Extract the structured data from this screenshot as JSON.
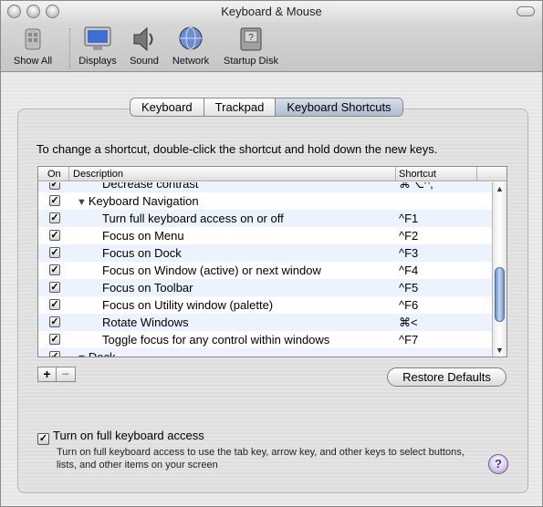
{
  "window": {
    "title": "Keyboard & Mouse"
  },
  "toolbar": {
    "show_all": "Show All",
    "items": [
      {
        "label": "Displays",
        "icon": "displays-icon"
      },
      {
        "label": "Sound",
        "icon": "speaker-icon"
      },
      {
        "label": "Network",
        "icon": "globe-icon"
      },
      {
        "label": "Startup Disk",
        "icon": "disk-icon"
      }
    ]
  },
  "tabs": [
    {
      "label": "Keyboard",
      "active": false
    },
    {
      "label": "Trackpad",
      "active": false
    },
    {
      "label": "Keyboard Shortcuts",
      "active": true
    }
  ],
  "instruction": "To change a shortcut, double-click the shortcut and hold down the new keys.",
  "table": {
    "columns": {
      "on": "On",
      "description": "Description",
      "shortcut": "Shortcut"
    },
    "rows": [
      {
        "on": true,
        "indent": 2,
        "description": "Decrease contrast",
        "shortcut": "⌘⌥^,"
      },
      {
        "on": true,
        "indent": 1,
        "group": true,
        "description": "Keyboard Navigation",
        "shortcut": ""
      },
      {
        "on": true,
        "indent": 2,
        "description": "Turn full keyboard access on or off",
        "shortcut": "^F1"
      },
      {
        "on": true,
        "indent": 2,
        "description": "Focus on Menu",
        "shortcut": "^F2"
      },
      {
        "on": true,
        "indent": 2,
        "description": "Focus on Dock",
        "shortcut": "^F3"
      },
      {
        "on": true,
        "indent": 2,
        "description": "Focus on Window (active) or next window",
        "shortcut": "^F4"
      },
      {
        "on": true,
        "indent": 2,
        "description": "Focus on Toolbar",
        "shortcut": "^F5"
      },
      {
        "on": true,
        "indent": 2,
        "description": "Focus on Utility window (palette)",
        "shortcut": "^F6"
      },
      {
        "on": true,
        "indent": 2,
        "description": "Rotate Windows",
        "shortcut": "⌘<"
      },
      {
        "on": true,
        "indent": 2,
        "description": "Toggle focus for any control within windows",
        "shortcut": "^F7"
      },
      {
        "on": true,
        "indent": 1,
        "group": true,
        "description": "Dock",
        "shortcut": ""
      }
    ]
  },
  "buttons": {
    "add": "+",
    "remove": "−",
    "restore_defaults": "Restore Defaults"
  },
  "full_keyboard_access": {
    "checked": true,
    "label": "Turn on full keyboard access",
    "description": "Turn on full keyboard access to use the tab key, arrow key, and other keys to select buttons, lists, and other items on your screen"
  },
  "help": "?"
}
